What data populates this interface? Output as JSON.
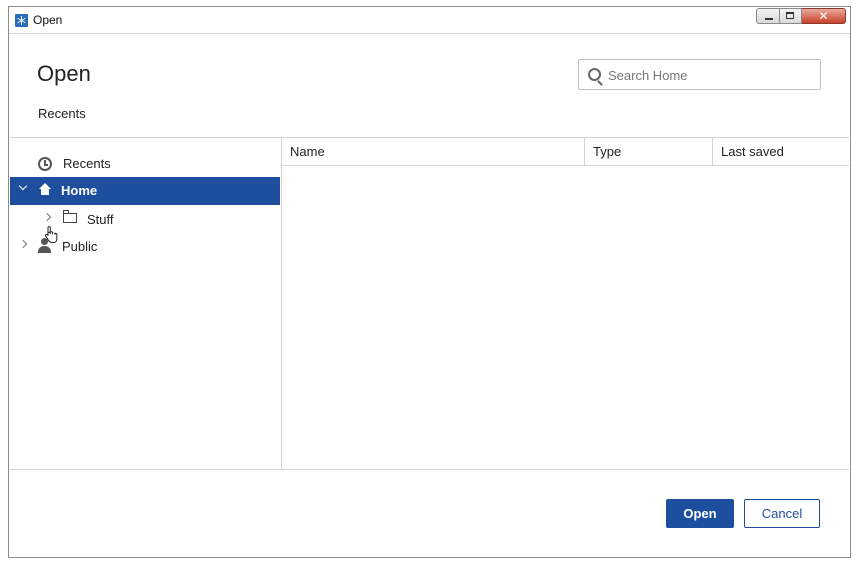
{
  "window": {
    "title": "Open",
    "controls": [
      "minimize",
      "maximize",
      "close"
    ]
  },
  "header": {
    "title": "Open",
    "location_label": "Recents"
  },
  "search": {
    "placeholder": "Search Home",
    "value": ""
  },
  "tree": {
    "items": [
      {
        "label": "Recents",
        "icon": "clock-icon",
        "expanded": false,
        "selected": false
      },
      {
        "label": "Home",
        "icon": "home-icon",
        "expanded": true,
        "selected": true
      },
      {
        "label": "Stuff",
        "icon": "folder-icon",
        "expanded": false,
        "selected": false
      },
      {
        "label": "Public",
        "icon": "user-icon",
        "expanded": false,
        "selected": false
      }
    ]
  },
  "file_list": {
    "columns": [
      "Name",
      "Type",
      "Last saved"
    ],
    "rows": []
  },
  "footer": {
    "open_label": "Open",
    "cancel_label": "Cancel"
  },
  "colors": {
    "accent": "#1d4f9e",
    "border": "#d4d4d4"
  }
}
